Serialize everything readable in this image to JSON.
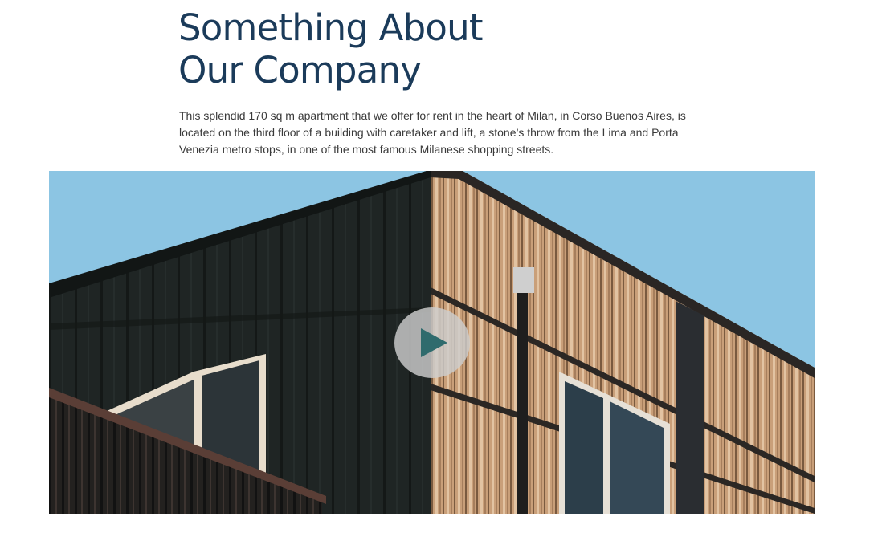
{
  "section": {
    "heading_line_1": "Something About",
    "heading_line_2": "Our Company",
    "description": "This splendid 170 sq m apartment that we offer for rent in the heart of Milan, in Corso Buenos Aires, is located on the third floor of a building with caretaker and lift, a stone’s throw from the Lima and Porta Venezia metro stops, in one of the most famous Milanese shopping streets."
  },
  "video": {
    "thumbnail": "modern-building-facade-photo",
    "play_icon": "play-icon",
    "colors": {
      "sky": "#8cc5e3",
      "dark_cladding": "#1d2322",
      "wood_cladding": "#c79c76",
      "play_circle": "#cdcdcd",
      "play_triangle": "#2f6b6d"
    }
  },
  "colors": {
    "heading": "#1b3b5a",
    "body_text": "#3a3a3a"
  }
}
